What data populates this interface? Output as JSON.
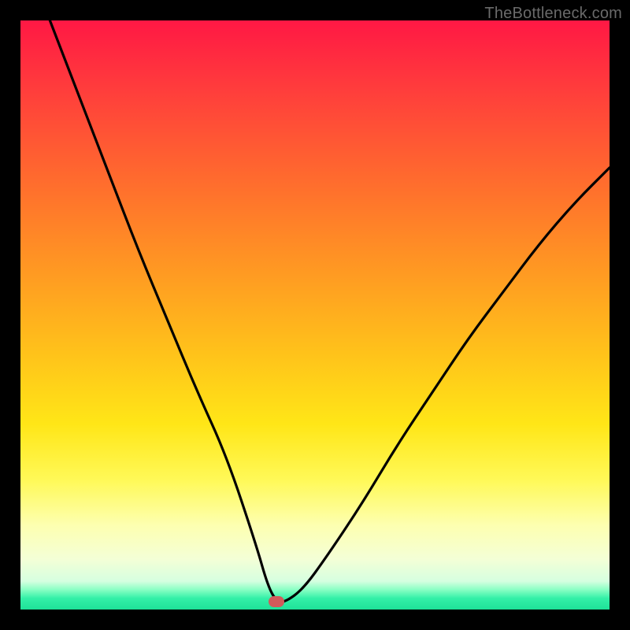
{
  "watermark": "TheBottleneck.com",
  "colors": {
    "frame": "#000000",
    "marker": "#d25a5a",
    "curve": "#000000"
  },
  "chart_data": {
    "type": "line",
    "title": "",
    "xlabel": "",
    "ylabel": "",
    "xlim": [
      0,
      100
    ],
    "ylim": [
      0,
      100
    ],
    "grid": false,
    "legend": false,
    "annotations": [
      {
        "kind": "marker",
        "x": 43.5,
        "y": 1.3,
        "label": ""
      }
    ],
    "series": [
      {
        "name": "bottleneck-curve",
        "x": [
          5,
          10,
          15,
          20,
          25,
          30,
          35,
          40,
          42,
          43.5,
          45,
          48,
          52,
          58,
          64,
          70,
          76,
          82,
          88,
          94,
          100
        ],
        "values": [
          100,
          87,
          74,
          61,
          49,
          37,
          26,
          11,
          4,
          1.3,
          1.3,
          3.5,
          9,
          18,
          28,
          37,
          46,
          54,
          62,
          69,
          75
        ]
      }
    ]
  }
}
